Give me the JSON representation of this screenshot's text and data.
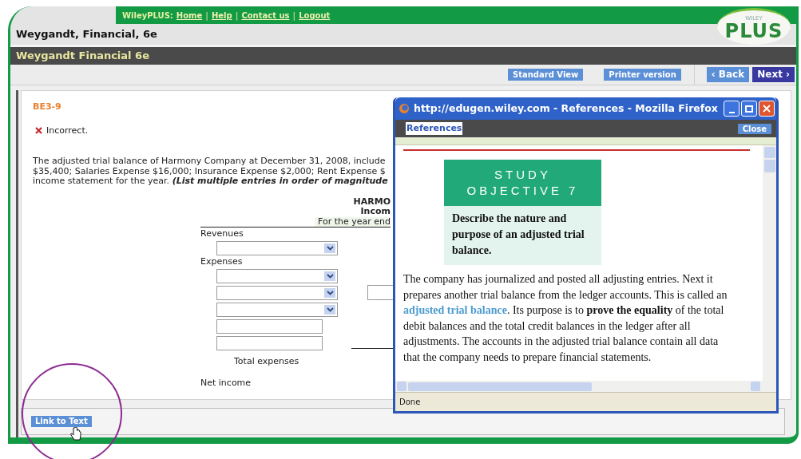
{
  "top_links": {
    "brand": "WileyPLUS:",
    "links": [
      "Home",
      "Help",
      "Contact us",
      "Logout"
    ],
    "separator": "|"
  },
  "course_title": "Weygandt, Financial, 6e",
  "logo": {
    "small": "WILEY",
    "big": "PLUS"
  },
  "section_bar": "Weygandt Financial 6e",
  "toolbar": {
    "buttons": [
      "Standard View",
      "Printer version"
    ],
    "nav": [
      {
        "label": "‹ Back",
        "kind": "back"
      },
      {
        "label": "Next ›",
        "kind": "next"
      }
    ]
  },
  "question": {
    "id": "BE3-9",
    "result": {
      "kind": "incorrect",
      "label": "Incorrect."
    },
    "lines": [
      "The adjusted trial balance of Harmony Company at December 31, 2008, include",
      "$35,400; Salaries Expense $16,000; Insurance Expense $2,000; Rent Expense $"
    ],
    "last_line": {
      "text": "income statement for the year.",
      "emphasis": "(List multiple entries in order of magnitude"
    }
  },
  "statement": {
    "heading": [
      "HARMO",
      "Incom"
    ],
    "period": "For the year end",
    "sections": [
      {
        "label": "Revenues",
        "rows": [
          {
            "kind": "select"
          }
        ]
      },
      {
        "label": "Expenses",
        "rows": [
          {
            "kind": "select"
          },
          {
            "kind": "select"
          },
          {
            "kind": "select"
          },
          {
            "kind": "input"
          },
          {
            "kind": "input"
          }
        ]
      }
    ],
    "total_label": "Total expenses",
    "net_label": "Net income"
  },
  "link_button": "Link to Text",
  "popup": {
    "title": "http://edugen.wiley.com - References - Mozilla Firefox",
    "toolbar_title": "References",
    "close": "Close",
    "objective": {
      "label_lines": [
        "STUDY",
        "OBJECTIVE 7"
      ],
      "text": "Describe the nature and purpose of an adjusted trial balance."
    },
    "paragraph": {
      "before": "The company has journalized and posted all adjusting entries. Next it prepares another trial balance from the ledger accounts. This is called an ",
      "link": "adjusted trial balance",
      "after": ". Its purpose is to **prove the equality** of the total debit balances and the total credit balances in the ledger after all adjustments. The accounts in the adjusted trial balance contain all data that the company needs to prepare financial statements."
    },
    "status": "Done"
  }
}
